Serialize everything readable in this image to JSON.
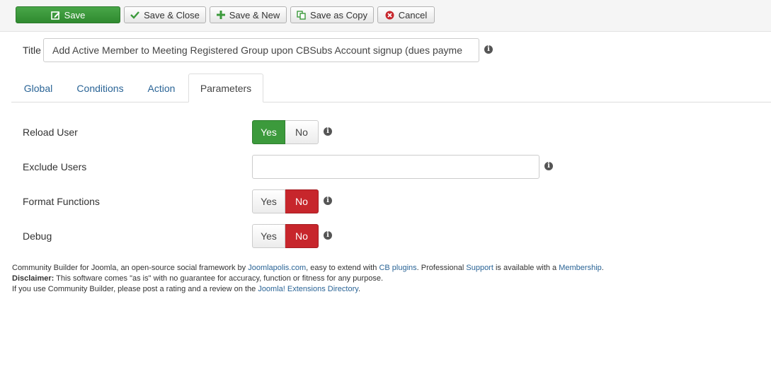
{
  "toolbar": {
    "save_label": "Save",
    "save_close_label": "Save & Close",
    "save_new_label": "Save & New",
    "save_copy_label": "Save as Copy",
    "cancel_label": "Cancel"
  },
  "title": {
    "label": "Title",
    "value": "Add Active Member to Meeting Registered Group upon CBSubs Account signup (dues payme"
  },
  "tabs": [
    {
      "label": "Global",
      "active": false
    },
    {
      "label": "Conditions",
      "active": false
    },
    {
      "label": "Action",
      "active": false
    },
    {
      "label": "Parameters",
      "active": true
    }
  ],
  "params": {
    "reload_user": {
      "label": "Reload User",
      "yes": "Yes",
      "no": "No",
      "selected": "Yes"
    },
    "exclude_users": {
      "label": "Exclude Users",
      "value": ""
    },
    "format_functions": {
      "label": "Format Functions",
      "yes": "Yes",
      "no": "No",
      "selected": "No"
    },
    "debug": {
      "label": "Debug",
      "yes": "Yes",
      "no": "No",
      "selected": "No"
    }
  },
  "footer": {
    "line1_a": "Community Builder for Joomla, an open-source social framework by ",
    "link_joomlapolis": "Joomlapolis.com",
    "line1_b": ", easy to extend with ",
    "link_cb_plugins": "CB plugins",
    "line1_c": ". Professional ",
    "link_support": "Support",
    "line1_d": " is available with a ",
    "link_membership": "Membership",
    "line1_e": ".",
    "disclaimer_label": "Disclaimer:",
    "disclaimer_text": " This software comes \"as is\" with no guarantee for accuracy, function or fitness for any purpose.",
    "line3_a": "If you use Community Builder, please post a rating and a review on the ",
    "link_jed": "Joomla! Extensions Directory",
    "line3_b": "."
  },
  "colors": {
    "save_green": "#3c9a3c",
    "yes_active": "#3c9a3c",
    "no_active": "#c7262c",
    "link": "#2a6496"
  },
  "icons": {
    "save": "edit-icon",
    "save_close": "check-icon",
    "save_new": "plus-icon",
    "save_copy": "copy-icon",
    "cancel": "cancel-circle-icon",
    "info": "info-icon"
  }
}
